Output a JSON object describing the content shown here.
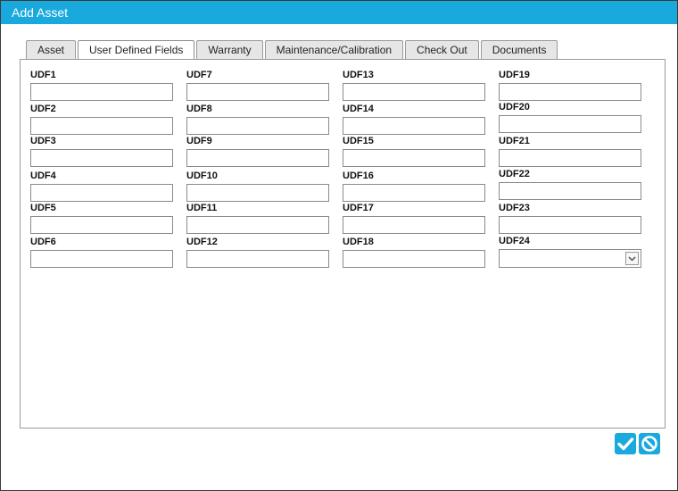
{
  "dialog": {
    "title": "Add Asset"
  },
  "tabs": [
    {
      "label": "Asset"
    },
    {
      "label": "User Defined Fields"
    },
    {
      "label": "Warranty"
    },
    {
      "label": "Maintenance/Calibration"
    },
    {
      "label": "Check Out"
    },
    {
      "label": "Documents"
    }
  ],
  "active_tab": "User Defined Fields",
  "fields": {
    "udf1": {
      "label": "UDF1",
      "value": ""
    },
    "udf2": {
      "label": "UDF2",
      "value": ""
    },
    "udf3": {
      "label": "UDF3",
      "value": ""
    },
    "udf4": {
      "label": "UDF4",
      "value": ""
    },
    "udf5": {
      "label": "UDF5",
      "value": ""
    },
    "udf6": {
      "label": "UDF6",
      "value": ""
    },
    "udf7": {
      "label": "UDF7",
      "value": ""
    },
    "udf8": {
      "label": "UDF8",
      "value": ""
    },
    "udf9": {
      "label": "UDF9",
      "value": ""
    },
    "udf10": {
      "label": "UDF10",
      "value": ""
    },
    "udf11": {
      "label": "UDF11",
      "value": ""
    },
    "udf12": {
      "label": "UDF12",
      "value": ""
    },
    "udf13": {
      "label": "UDF13",
      "value": ""
    },
    "udf14": {
      "label": "UDF14",
      "value": ""
    },
    "udf15": {
      "label": "UDF15",
      "value": ""
    },
    "udf16": {
      "label": "UDF16",
      "value": ""
    },
    "udf17": {
      "label": "UDF17",
      "value": ""
    },
    "udf18": {
      "label": "UDF18",
      "value": ""
    },
    "udf19": {
      "label": "UDF19",
      "value": ""
    },
    "udf20": {
      "label": "UDF20",
      "value": ""
    },
    "udf21": {
      "label": "UDF21",
      "value": ""
    },
    "udf22": {
      "label": "UDF22",
      "value": ""
    },
    "udf23": {
      "label": "UDF23",
      "value": ""
    },
    "udf24": {
      "label": "UDF24",
      "selected": ""
    }
  },
  "actions": {
    "confirm_icon": "checkmark-icon",
    "cancel_icon": "cancel-icon"
  },
  "colors": {
    "accent": "#1aa9dd"
  }
}
